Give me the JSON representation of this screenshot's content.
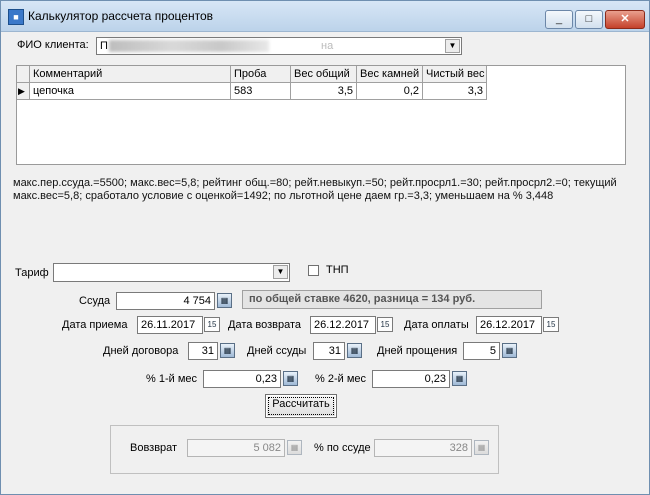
{
  "window": {
    "title": "Калькулятор рассчета процентов",
    "controls": {
      "minimize": "_",
      "maximize": "□",
      "close": "✕"
    }
  },
  "client": {
    "label": "ФИО клиента:",
    "value_visible": "П",
    "value_tail": "на"
  },
  "grid": {
    "columns": [
      "Комментарий",
      "Проба",
      "Вес общий",
      "Вес камней",
      "Чистый вес"
    ],
    "rows": [
      {
        "indicator": "▶",
        "comment": "цепочка",
        "probe": "583",
        "total_weight": "3,5",
        "stone_weight": "0,2",
        "net_weight": "3,3"
      }
    ]
  },
  "info": {
    "line1": "макс.пер.ссуда.=5500; макс.вес=5,8; рейтинг общ.=80; рейт.невыкуп.=50; рейт.просрл1.=30; рейт.просрл2.=0; текущий",
    "line2": "макс.вес=5,8; сработало условие с оценкой=1492; по льготной цене даем гр.=3,3; уменьшаем на % 3,448"
  },
  "tariff": {
    "label": "Тариф",
    "value": "",
    "tnp_label": "ТНП",
    "tnp_checked": false
  },
  "loan": {
    "label": "Ссуда",
    "value": "4 754",
    "summary": "по общей ставке 4620, разница = 134 руб."
  },
  "dates": {
    "receipt_label": "Дата приема",
    "receipt_value": "26.11.2017",
    "return_label": "Дата возврата",
    "return_value": "26.12.2017",
    "payment_label": "Дата оплаты",
    "payment_value": "26.12.2017",
    "cal_glyph": "15"
  },
  "days": {
    "contract_label": "Дней договора",
    "contract_value": "31",
    "loan_label": "Дней ссуды",
    "loan_value": "31",
    "forgiveness_label": "Дней прощения",
    "forgiveness_value": "5"
  },
  "rates": {
    "month1_label": "% 1-й мес",
    "month1_value": "0,23",
    "month2_label": "% 2-й мес",
    "month2_value": "0,23"
  },
  "calculate_button": "Рассчитать",
  "result": {
    "return_label": "Вовзврат",
    "return_value": "5 082",
    "percent_label": "% по ссуде",
    "percent_value": "328"
  },
  "icons": {
    "dropdown": "chevron-down-icon",
    "calculator": "calculator-icon",
    "calendar": "calendar-icon"
  }
}
